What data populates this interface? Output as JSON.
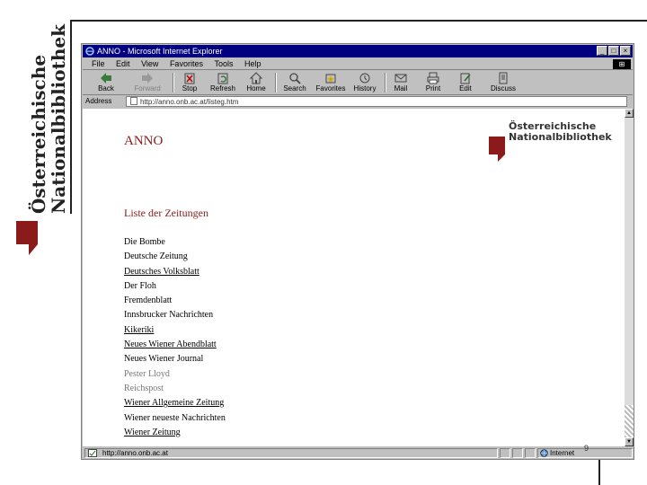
{
  "side_logo": {
    "line1": "Österreichische",
    "line2": "Nationalbibliothek",
    "accent": "#8b1a1a"
  },
  "window": {
    "title": "ANNO - Microsoft Internet Explorer",
    "controls": [
      "_",
      "□",
      "×"
    ]
  },
  "menubar": [
    "File",
    "Edit",
    "View",
    "Favorites",
    "Tools",
    "Help"
  ],
  "toolbar": {
    "back": "Back",
    "forward": "Forward",
    "stop": "Stop",
    "refresh": "Refresh",
    "home": "Home",
    "search": "Search",
    "favorites": "Favorites",
    "history": "History",
    "mail": "Mail",
    "print": "Print",
    "edit": "Edit",
    "discuss": "Discuss"
  },
  "address": {
    "label": "Address",
    "value": "http://anno.onb.ac.at/listeg.htm"
  },
  "page": {
    "brand": "ANNO",
    "logo_line1": "Österreichische",
    "logo_line2": "Nationalbibliothek",
    "list_heading": "Liste der Zeitungen",
    "newspapers": [
      {
        "name": "Die Bombe",
        "style": "plain"
      },
      {
        "name": "Deutsche Zeitung",
        "style": "plain"
      },
      {
        "name": "Deutsches Volksblatt",
        "style": "link"
      },
      {
        "name": "Der Floh",
        "style": "plain"
      },
      {
        "name": "Fremdenblatt",
        "style": "plain"
      },
      {
        "name": "Innsbrucker Nachrichten",
        "style": "plain"
      },
      {
        "name": "Kikeriki",
        "style": "link"
      },
      {
        "name": "Neues Wiener Abendblatt",
        "style": "link"
      },
      {
        "name": "Neues Wiener Journal",
        "style": "plain"
      },
      {
        "name": "Pester Lloyd",
        "style": "grey"
      },
      {
        "name": "Reichspost",
        "style": "grey"
      },
      {
        "name": "Wiener Allgemeine Zeitung",
        "style": "link"
      },
      {
        "name": "Wiener neueste Nachrichten",
        "style": "plain"
      },
      {
        "name": "Wiener Zeitung",
        "style": "link"
      }
    ]
  },
  "status": {
    "text": "http://anno.onb.ac.at",
    "zone": "Internet"
  },
  "slide_number": "9",
  "colors": {
    "titlebar": "#000080",
    "chrome": "#c0c0c0",
    "brand_red": "#8b1a1a"
  }
}
